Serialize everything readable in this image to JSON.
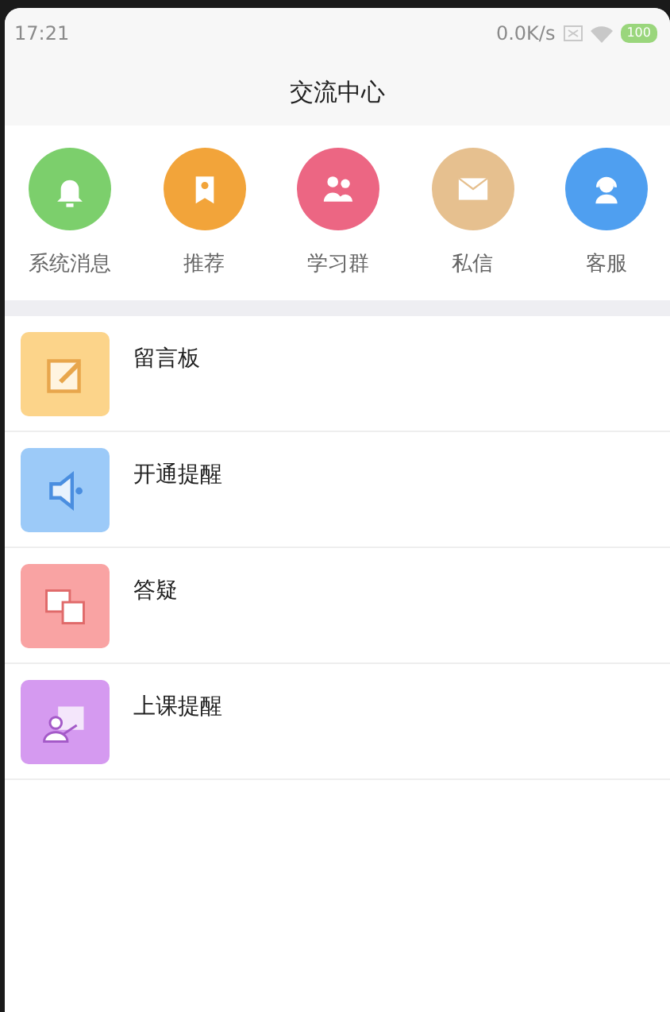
{
  "status_bar": {
    "time": "17:21",
    "speed": "0.0K/s",
    "battery": "100"
  },
  "title": "交流中心",
  "shortcuts": [
    {
      "label": "系统消息",
      "kind": "bell",
      "color": "#7ccf6c"
    },
    {
      "label": "推荐",
      "kind": "bookmark",
      "color": "#f2a43a"
    },
    {
      "label": "学习群",
      "kind": "group",
      "color": "#ec6683"
    },
    {
      "label": "私信",
      "kind": "mail",
      "color": "#e6c08f"
    },
    {
      "label": "客服",
      "kind": "agent",
      "color": "#4f9ff0"
    }
  ],
  "list": [
    {
      "label": "留言板",
      "kind": "note",
      "color": "#fcd48a"
    },
    {
      "label": "开通提醒",
      "kind": "speaker",
      "color": "#9ccaf8"
    },
    {
      "label": "答疑",
      "kind": "chat",
      "color": "#f9a3a3"
    },
    {
      "label": "上课提醒",
      "kind": "teacher",
      "color": "#d59af0"
    }
  ]
}
